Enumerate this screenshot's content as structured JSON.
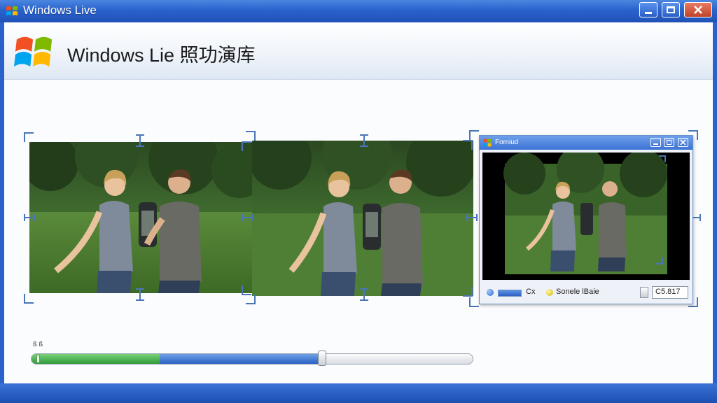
{
  "window": {
    "title": "Windows Live",
    "controls": {
      "minimize": "minimize-icon",
      "maximize": "maximize-icon",
      "close": "close-icon"
    }
  },
  "header": {
    "title": "Windows Lie 照功演库",
    "logo_icon": "windows-flag-icon"
  },
  "sub_window": {
    "title": "Fomiud",
    "logo_icon": "windows-flag-icon",
    "status": {
      "left_text": "Cx",
      "middle_text": "Sonele lBaie",
      "right_value": "C5.817"
    }
  },
  "progress": {
    "label": "ß ß",
    "green_fraction": 0.29,
    "blue_fraction": 0.66
  },
  "colors": {
    "titlebar": "#2a62cc",
    "progress_green": "#2f9a3a",
    "progress_blue": "#2b61c2",
    "frame_blue": "#2a62cc"
  }
}
